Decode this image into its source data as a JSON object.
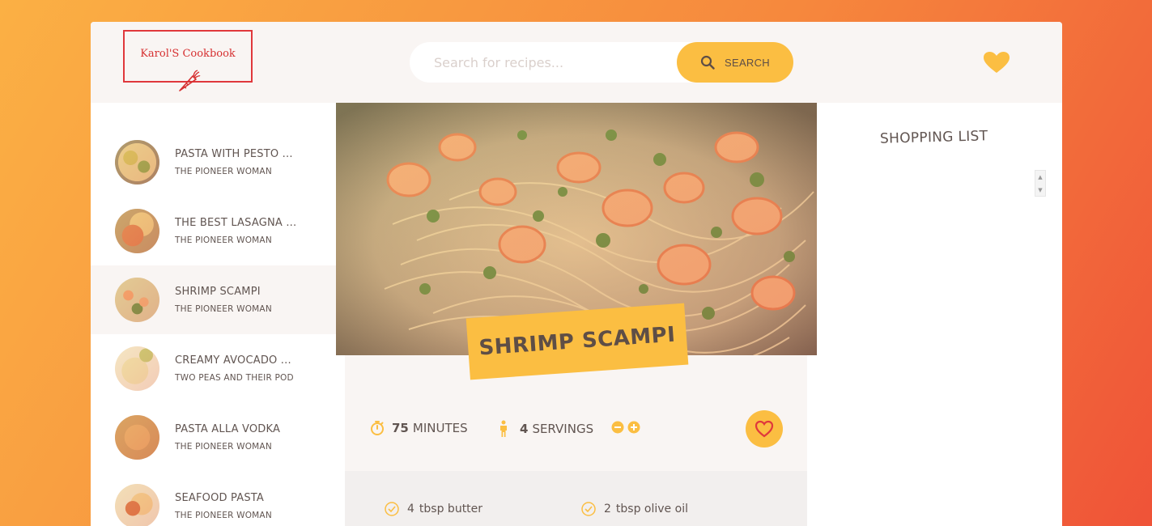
{
  "app": {
    "logo_text": "Karol'S Cookbook",
    "accent_color": "#fbbe42",
    "text_color": "#615551"
  },
  "search": {
    "placeholder": "Search for recipes...",
    "button_label": "SEARCH",
    "icon": "search-icon"
  },
  "header": {
    "likes_icon": "heart-icon"
  },
  "results": [
    {
      "title": "PASTA WITH PESTO ...",
      "publisher": "THE PIONEER WOMAN",
      "active": false
    },
    {
      "title": "THE BEST LASAGNA ...",
      "publisher": "THE PIONEER WOMAN",
      "active": false
    },
    {
      "title": "SHRIMP SCAMPI",
      "publisher": "THE PIONEER WOMAN",
      "active": true
    },
    {
      "title": "CREAMY AVOCADO ...",
      "publisher": "TWO PEAS AND THEIR POD",
      "active": false
    },
    {
      "title": "PASTA ALLA VODKA",
      "publisher": "THE PIONEER WOMAN",
      "active": false
    },
    {
      "title": "SEAFOOD PASTA",
      "publisher": "THE PIONEER WOMAN",
      "active": false
    }
  ],
  "recipe": {
    "title": "SHRIMP SCAMPI",
    "time_value": "75",
    "time_unit": "MINUTES",
    "servings_value": "4",
    "servings_unit": "SERVINGS",
    "ingredients": [
      {
        "amount": "4",
        "text": "tbsp butter"
      },
      {
        "amount": "2",
        "text": "tbsp olive oil"
      }
    ]
  },
  "shopping": {
    "title": "SHOPPING LIST"
  }
}
